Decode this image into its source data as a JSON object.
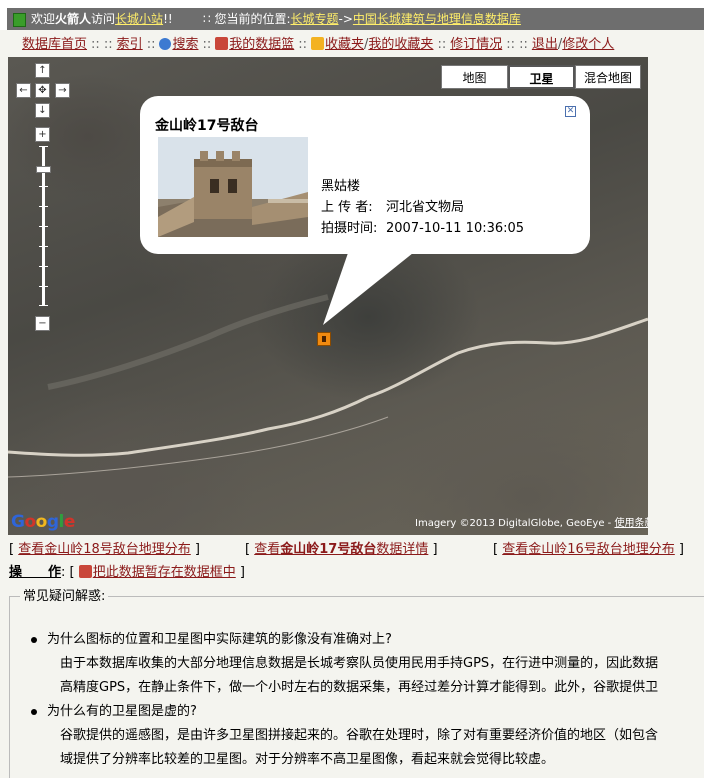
{
  "topbar": {
    "welcome_prefix": "欢迎",
    "username": "火箭人",
    "welcome_middle": "访问",
    "site_link": "长城小站",
    "welcome_suffix": "!!",
    "location_label": "∷ 您当前的位置:",
    "crumb1": "长城专题",
    "crumb_sep": "->",
    "crumb2": "中国长城建筑与地理信息数据库"
  },
  "nav": {
    "home": "数据库首页",
    "index": "索引",
    "search": "搜索",
    "my_basket": "我的数据篮",
    "favorites": "收藏夹",
    "my_favorites": "我的收藏夹",
    "revisions": "修订情况",
    "logout": "退出",
    "edit_profile": "修改个人",
    "sep": "::",
    "sep3": ":: ::"
  },
  "map": {
    "types": [
      "地图",
      "卫星",
      "混合地图"
    ],
    "active_type": "卫星",
    "popup": {
      "title": "金山岭17号敌台",
      "photo_name": "黑姑楼",
      "uploader_label": "上 传 者:",
      "uploader": "河北省文物局",
      "time_label": "拍摄时间:",
      "time": "2007-10-11 10:36:05"
    },
    "logo_letters": [
      "G",
      "o",
      "o",
      "g",
      "l",
      "e"
    ],
    "imagery_text": "Imagery ©2013 DigitalGlobe, GeoEye - ",
    "terms_link": "使用条款"
  },
  "links": {
    "prev_pre": "查看",
    "prev_name": "金山岭18号敌台",
    "prev_post": "地理分布",
    "cur_pre": "查看",
    "cur_name": "金山岭17号敌台",
    "cur_post": "数据详情",
    "next_pre": "查看",
    "next_name": "金山岭16号敌台",
    "next_post": "地理分布"
  },
  "ops": {
    "label": "操　　作",
    "action": "把此数据暂存在数据框中"
  },
  "faq": {
    "title": "常见疑问解惑:",
    "items": [
      {
        "q": "为什么图标的位置和卫星图中实际建筑的影像没有准确对上?",
        "a1": "由于本数据库收集的大部分地理信息数据是长城考察队员使用民用手持GPS，在行进中测量的，因此数据",
        "a2": "高精度GPS，在静止条件下，做一个小时左右的数据采集，再经过差分计算才能得到。此外，谷歌提供卫"
      },
      {
        "q": "为什么有的卫星图是虚的?",
        "a1": "谷歌提供的遥感图，是由许多卫星图拼接起来的。谷歌在处理时，除了对有重要经济价值的地区（如包含",
        "a2": "域提供了分辨率比较差的卫星图。对于分辨率不高卫星图像，看起来就会觉得比较虚。"
      }
    ]
  }
}
